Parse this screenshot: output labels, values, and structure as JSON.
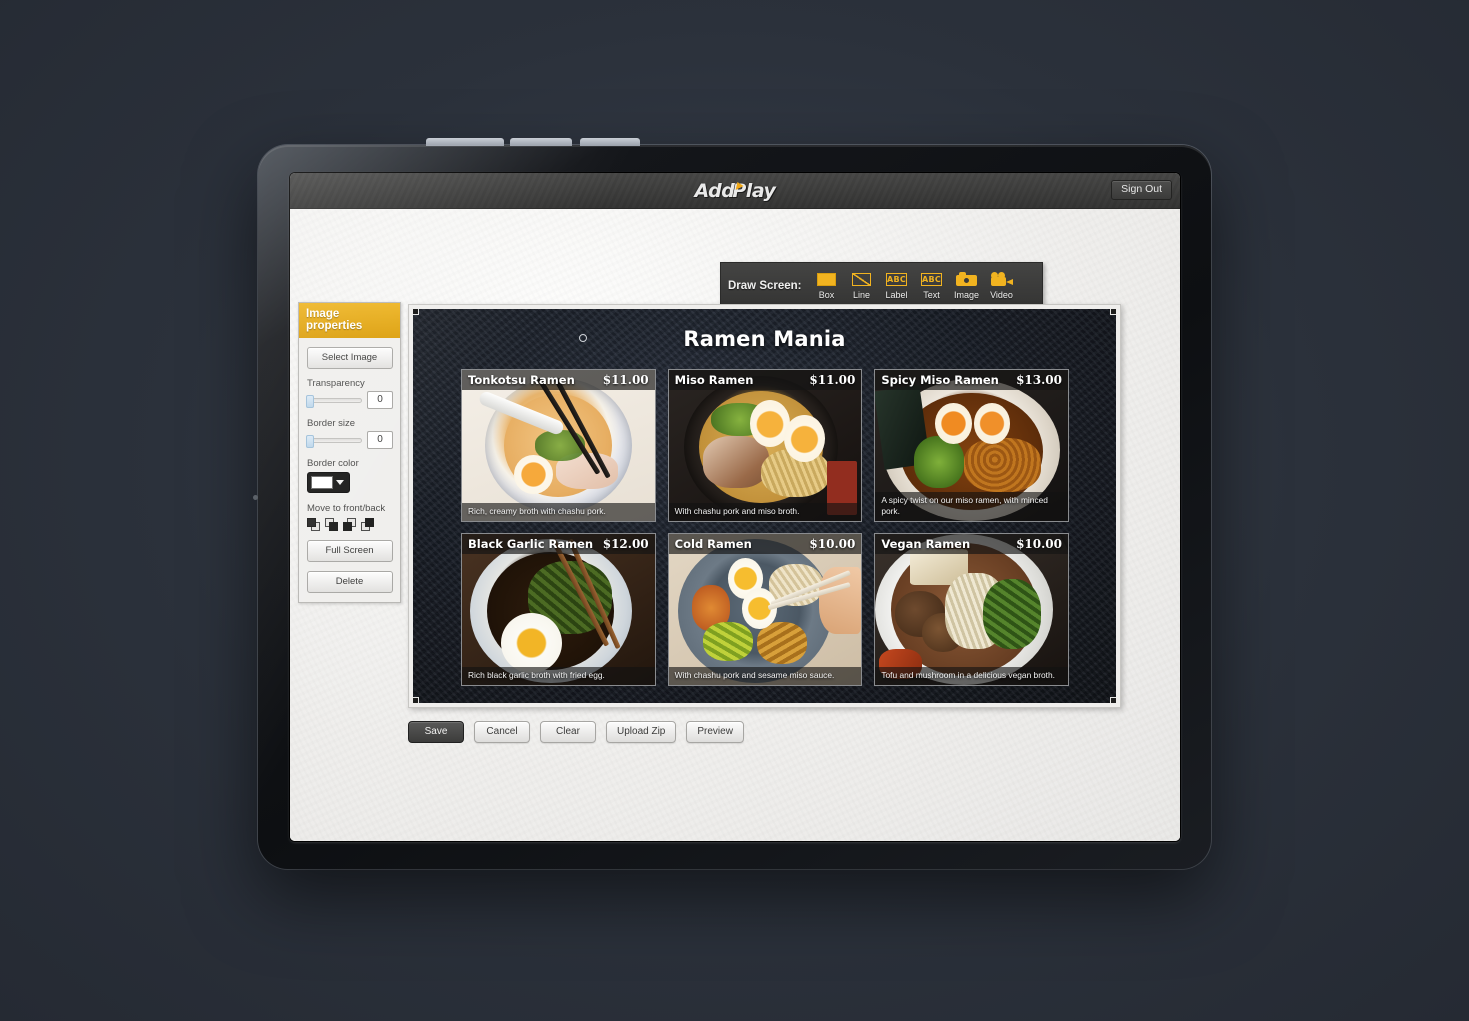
{
  "app": {
    "logo_add": "Add",
    "logo_play": "Play",
    "sign_out": "Sign Out"
  },
  "draw_screen": {
    "label": "Draw Screen:",
    "tools": [
      {
        "label": "Box",
        "icon": "box-icon"
      },
      {
        "label": "Line",
        "icon": "line-icon"
      },
      {
        "label": "Label",
        "icon": "label-abc-icon"
      },
      {
        "label": "Text",
        "icon": "text-abc-icon"
      },
      {
        "label": "Image",
        "icon": "camera-icon"
      },
      {
        "label": "Video",
        "icon": "video-camera-icon"
      }
    ]
  },
  "properties_panel": {
    "title": "Image properties",
    "select_image": "Select Image",
    "transparency_label": "Transparency",
    "transparency_value": "0",
    "border_size_label": "Border size",
    "border_size_value": "0",
    "border_color_label": "Border color",
    "border_color_value": "#ffffff",
    "move_label": "Move to front/back",
    "full_screen": "Full Screen",
    "delete": "Delete"
  },
  "canvas": {
    "board_title": "Ramen Mania",
    "items": [
      {
        "name": "Tonkotsu Ramen",
        "price": "$11.00",
        "desc": "Rich, creamy broth with chashu pork."
      },
      {
        "name": "Miso Ramen",
        "price": "$11.00",
        "desc": "With chashu pork and miso broth."
      },
      {
        "name": "Spicy Miso Ramen",
        "price": "$13.00",
        "desc": "A spicy twist on our miso ramen, with minced pork."
      },
      {
        "name": "Black Garlic Ramen",
        "price": "$12.00",
        "desc": "Rich black garlic broth with fried egg."
      },
      {
        "name": "Cold Ramen",
        "price": "$10.00",
        "desc": "With chashu pork and sesame miso sauce."
      },
      {
        "name": "Vegan Ramen",
        "price": "$10.00",
        "desc": "Tofu and mushroom in a delicious vegan broth."
      }
    ]
  },
  "actions": {
    "buttons": [
      {
        "label": "Save",
        "active": true
      },
      {
        "label": "Cancel",
        "active": false
      },
      {
        "label": "Clear",
        "active": false
      },
      {
        "label": "Upload Zip",
        "active": false
      },
      {
        "label": "Preview",
        "active": false
      }
    ]
  },
  "colors": {
    "accent": "#e8a915",
    "toolbar_bg": "#3a3a39",
    "appbar_bg": "#3e3e3d",
    "logo_play_triangle": "#f0a818",
    "desktop_bg": "#2e3440"
  }
}
